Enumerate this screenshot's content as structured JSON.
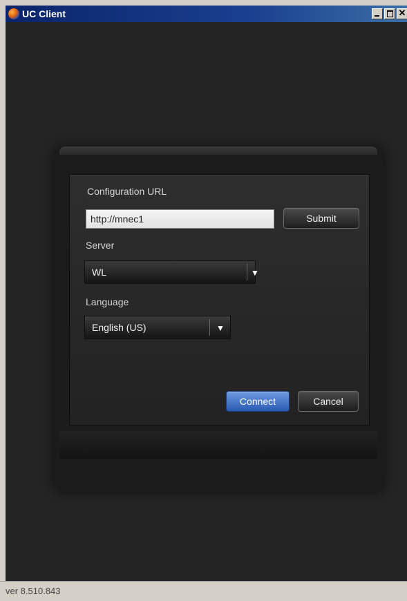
{
  "window": {
    "title": "UC Client",
    "minimize_glyph": "",
    "maximize_glyph": "",
    "close_glyph": "✕"
  },
  "dialog": {
    "config_url_label": "Configuration URL",
    "config_url_value": "http://mnec1",
    "submit_label": "Submit",
    "server_label": "Server",
    "server_value": "WL",
    "language_label": "Language",
    "language_value": "English (US)",
    "dropdown_arrow": "▼",
    "connect_label": "Connect",
    "cancel_label": "Cancel"
  },
  "status": {
    "version": "ver 8.510.843"
  }
}
